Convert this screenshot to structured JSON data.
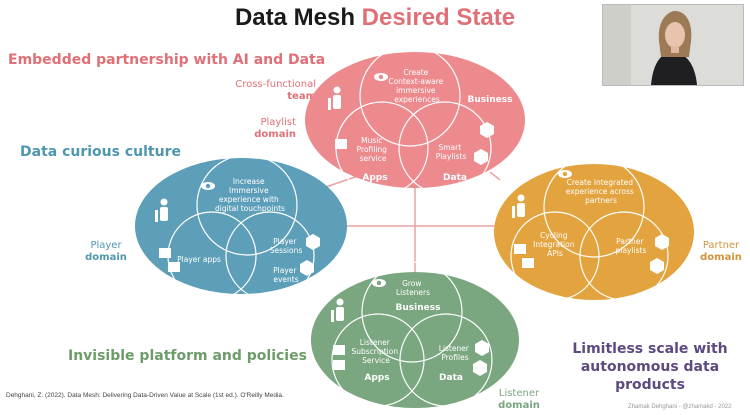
{
  "slide": {
    "title_part1": "Data Mesh",
    "title_part2": "Desired State",
    "themes": {
      "embedded": "Embedded partnership with AI and Data",
      "curious": "Data curious culture",
      "invisible": "Invisible platform and policies",
      "limitless_line1": "Limitless scale with",
      "limitless_line2": "autonomous data products"
    },
    "labels": {
      "cross_functional_line1": "Cross-functional",
      "cross_functional_line2": "team",
      "playlist_line1": "Playlist",
      "playlist_line2": "domain",
      "player_line1": "Player",
      "player_line2": "domain",
      "partner_line1": "Partner",
      "partner_line2": "domain",
      "listener_line1": "Listener",
      "listener_line2": "domain"
    },
    "citation": "Dehghani, Z. (2022). Data Mesh: Delivering Data-Driven Value at Scale (1st ed.). O'Reilly Media.",
    "credit": "Zhamak Dehghani - @zhamakd - 2022"
  },
  "domains": {
    "playlist": {
      "purpose": [
        "Create",
        "Context-aware",
        "immersive",
        "experiences"
      ],
      "business": "Business",
      "apps_text": [
        "Music",
        "Profiling",
        "service"
      ],
      "apps": "Apps",
      "data_text": [
        "Smart",
        "Playlists"
      ],
      "data": "Data"
    },
    "player": {
      "purpose": [
        "Increase",
        "Immersive",
        "experience with",
        "digital touchpoints"
      ],
      "apps_text": [
        "Player apps"
      ],
      "data_text1": [
        "Player",
        "Sessions"
      ],
      "data_text2": [
        "Player",
        "events"
      ]
    },
    "partner": {
      "purpose": [
        "Create integrated",
        "experience across",
        "partners"
      ],
      "apps_text": [
        "Cycling",
        "Integration",
        "APIs"
      ],
      "data_text": [
        "Partner",
        "playlists"
      ]
    },
    "listener": {
      "purpose": [
        "Grow",
        "Listeners"
      ],
      "business": "Business",
      "apps_text": [
        "Listener",
        "Subscription",
        "Service"
      ],
      "apps": "Apps",
      "data_text": [
        "Listener",
        "Profiles"
      ],
      "data": "Data"
    }
  },
  "colors": {
    "playlist": "#ec8a8e",
    "player": "#5d9fb8",
    "partner": "#e3a33e",
    "listener": "#7aa680",
    "title_accent": "#e07077",
    "embedded_theme": "#e07077",
    "curious_theme": "#4f97b0",
    "invisible_theme": "#6d9c6a",
    "limitless_theme": "#5e4a82"
  }
}
